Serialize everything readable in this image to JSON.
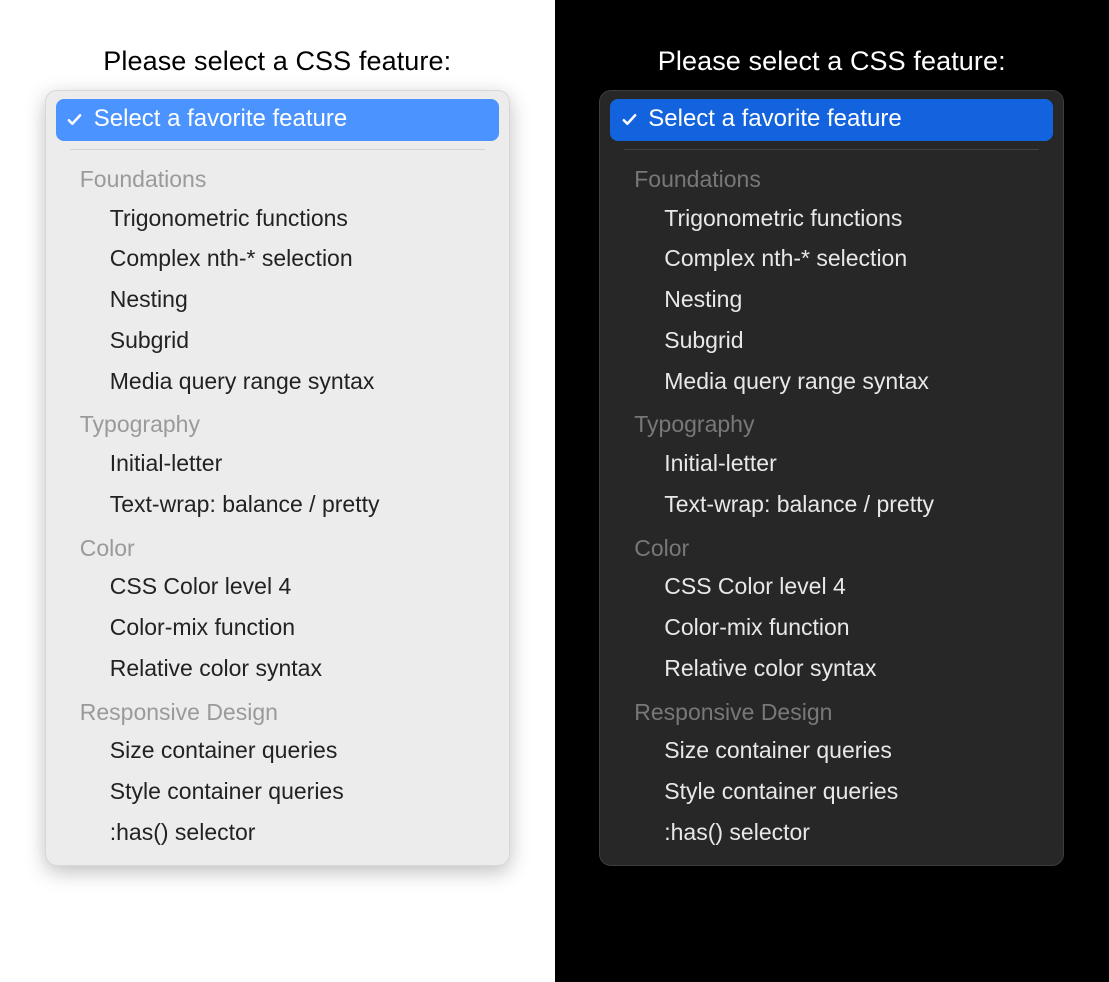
{
  "prompt_text": "Please select a CSS feature:",
  "selected_label": "Select a favorite feature",
  "colors": {
    "light_accent": "#4b93ff",
    "dark_accent": "#1463de"
  },
  "groups": [
    {
      "label": "Foundations",
      "options": [
        "Trigonometric functions",
        "Complex nth-* selection",
        "Nesting",
        "Subgrid",
        "Media query range syntax"
      ]
    },
    {
      "label": "Typography",
      "options": [
        "Initial-letter",
        "Text-wrap: balance / pretty"
      ]
    },
    {
      "label": "Color",
      "options": [
        "CSS Color level 4",
        "Color-mix function",
        "Relative color syntax"
      ]
    },
    {
      "label": "Responsive Design",
      "options": [
        "Size container queries",
        "Style container queries",
        ":has() selector"
      ]
    }
  ]
}
